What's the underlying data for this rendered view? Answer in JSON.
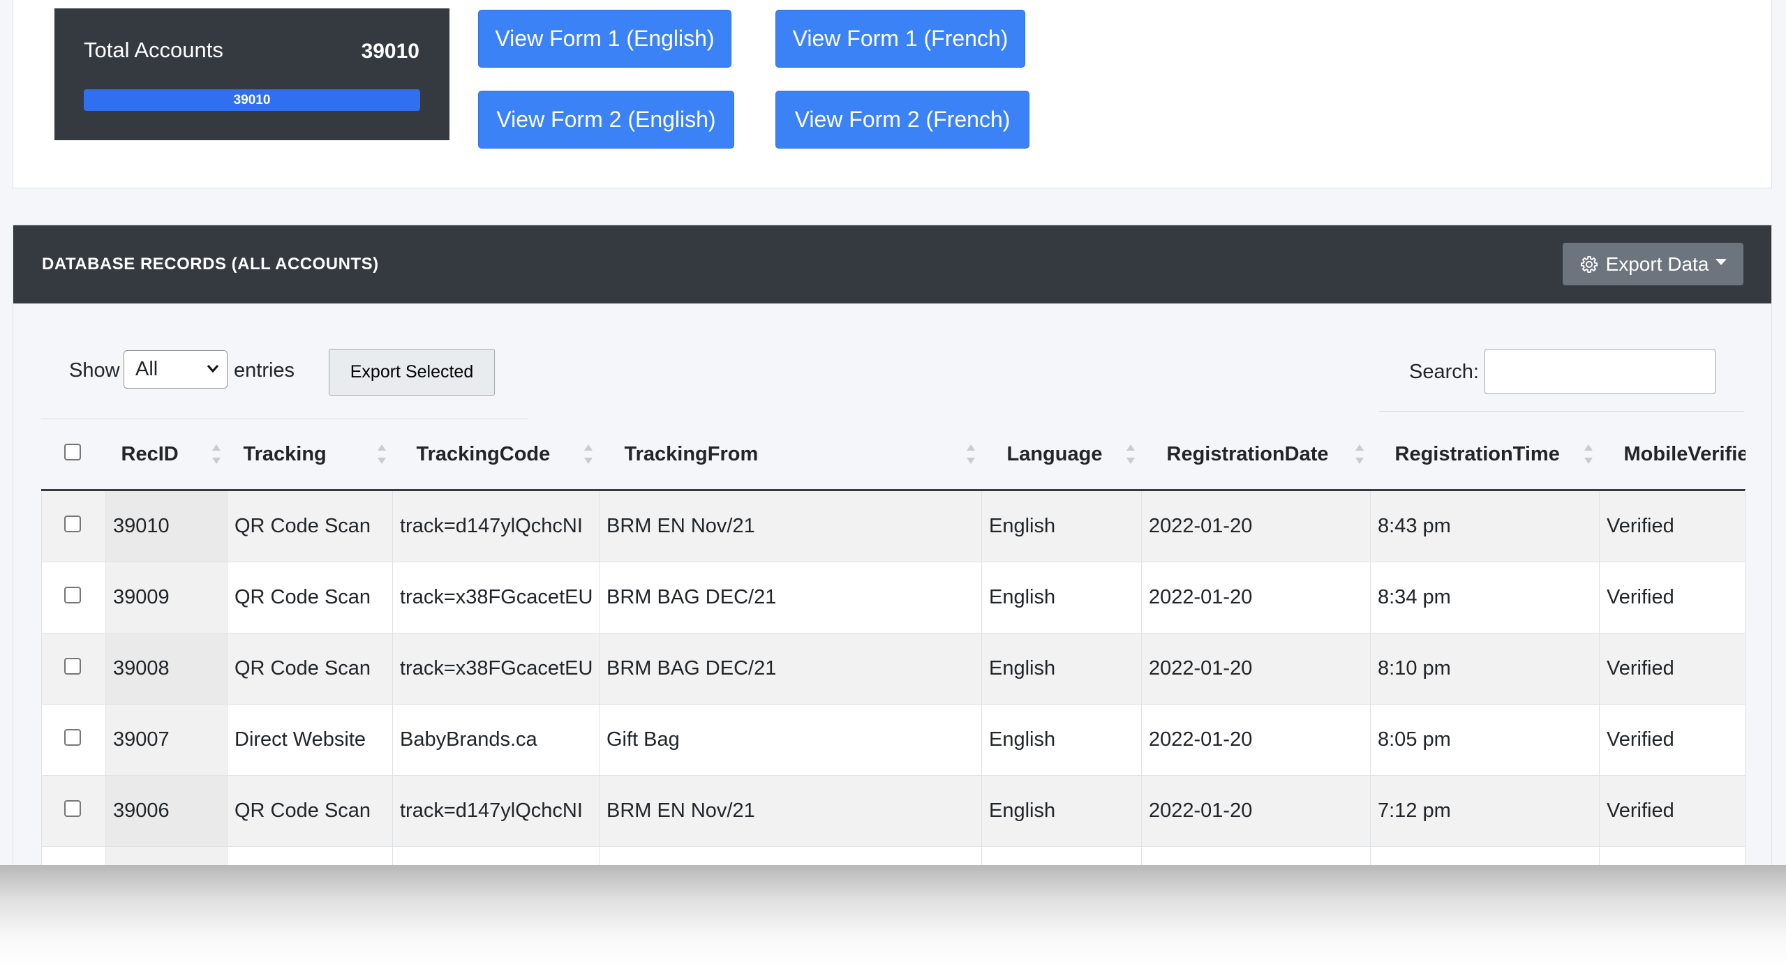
{
  "summary": {
    "label": "Total Accounts",
    "value": "39010",
    "bar_text": "39010",
    "bar_fraction": 1.0
  },
  "form_buttons": [
    "View Form 1 (English)",
    "View Form 1 (French)",
    "View Form 2 (English)",
    "View Form 2 (French)"
  ],
  "records": {
    "title": "DATABASE RECORDS (ALL ACCOUNTS)",
    "export_data_label": "Export Data",
    "show_label": "Show",
    "show_selected": "All",
    "entries_label": "entries",
    "export_selected_label": "Export Selected",
    "search_label": "Search:",
    "search_value": "",
    "columns": [
      "RecID",
      "Tracking",
      "TrackingCode",
      "TrackingFrom",
      "Language",
      "RegistrationDate",
      "RegistrationTime",
      "MobileVerifie"
    ],
    "rows": [
      [
        "39010",
        "QR Code Scan",
        "track=d147ylQchcNI",
        "BRM EN Nov/21",
        "English",
        "2022-01-20",
        "8:43 pm",
        "Verified"
      ],
      [
        "39009",
        "QR Code Scan",
        "track=x38FGcacetEU",
        "BRM BAG DEC/21",
        "English",
        "2022-01-20",
        "8:34 pm",
        "Verified"
      ],
      [
        "39008",
        "QR Code Scan",
        "track=x38FGcacetEU",
        "BRM BAG DEC/21",
        "English",
        "2022-01-20",
        "8:10 pm",
        "Verified"
      ],
      [
        "39007",
        "Direct Website",
        "BabyBrands.ca",
        "Gift Bag",
        "English",
        "2022-01-20",
        "8:05 pm",
        "Verified"
      ],
      [
        "39006",
        "QR Code Scan",
        "track=d147ylQchcNI",
        "BRM EN Nov/21",
        "English",
        "2022-01-20",
        "7:12 pm",
        "Verified"
      ],
      [
        "",
        "",
        "",
        "",
        "",
        "",
        "",
        ""
      ]
    ]
  },
  "colors": {
    "dark": "#343a40",
    "primary": "#3b82f6",
    "secondary": "#6c757d"
  },
  "icons": [
    "gear-icon",
    "caret-down-icon",
    "sort-icon",
    "checkbox"
  ]
}
